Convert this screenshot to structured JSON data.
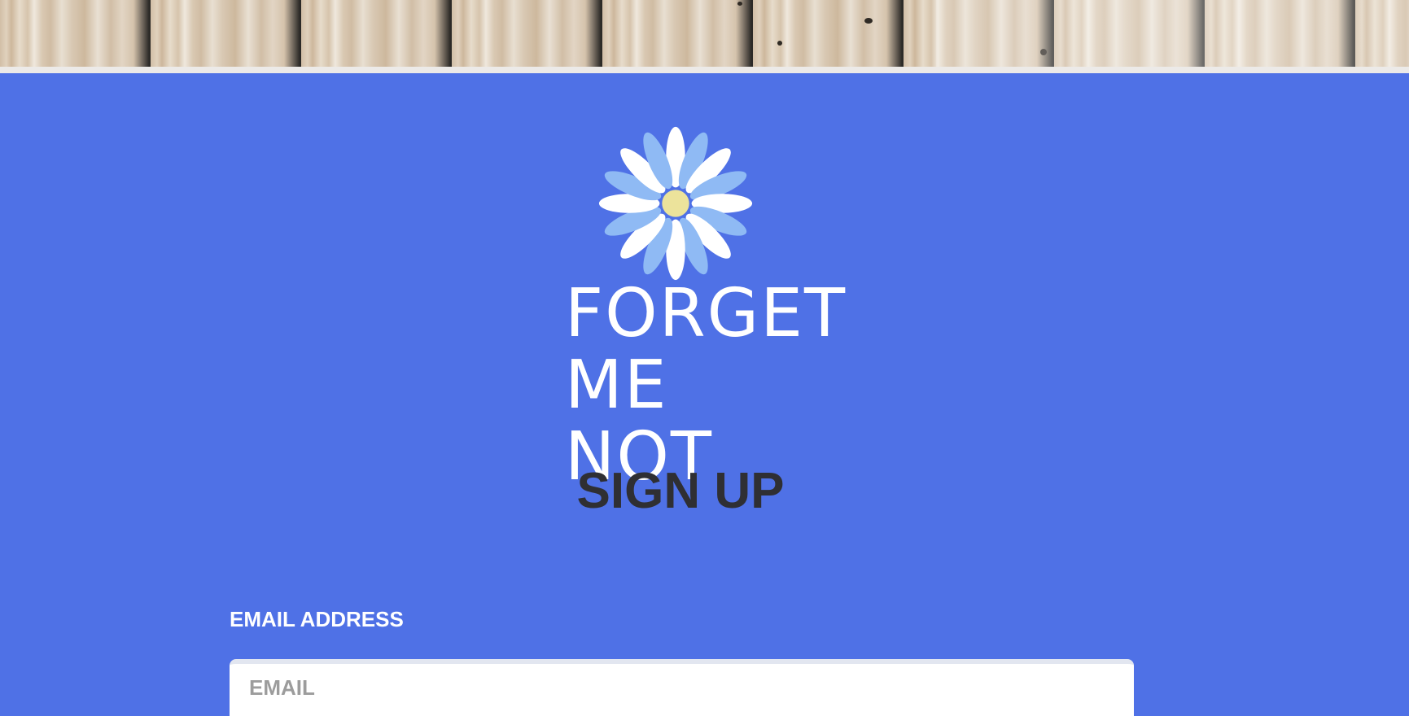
{
  "brand": {
    "line1": "FORGET",
    "line2": "ME NOT",
    "logo_icon": "flower-icon"
  },
  "form": {
    "title": "SIGN UP",
    "email_label": "EMAIL ADDRESS",
    "email_placeholder": "EMAIL",
    "email_value": ""
  },
  "colors": {
    "background": "#4f71e6",
    "title_text": "#2f2f33",
    "label_text": "#ffffff",
    "petal_light_blue": "#8fbaf4",
    "petal_white": "#ffffff",
    "flower_center": "#ece39b"
  }
}
